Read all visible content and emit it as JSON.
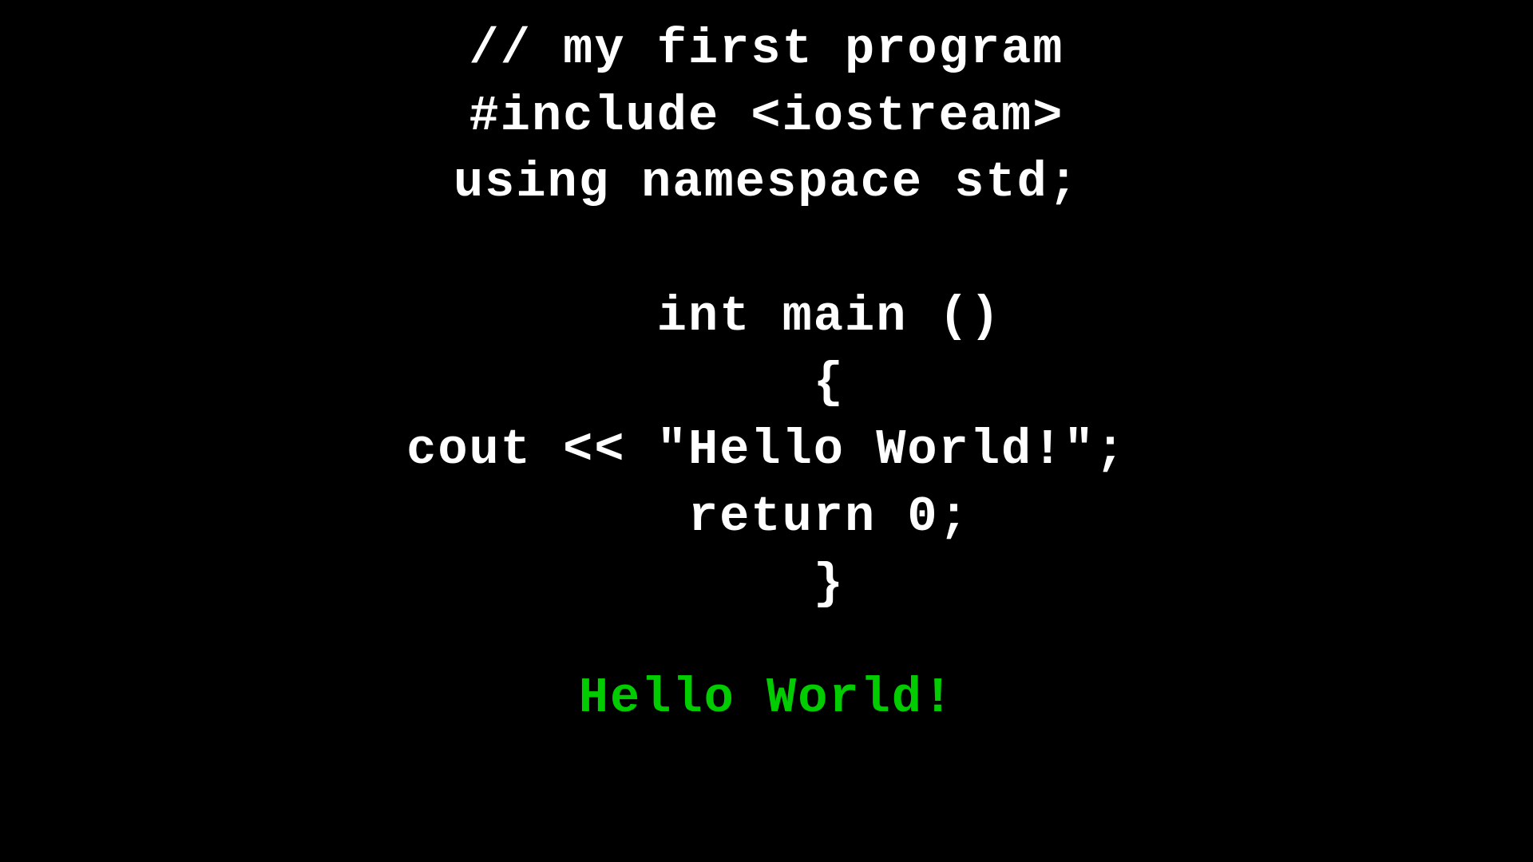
{
  "code": {
    "line1": "// my first program",
    "line2": "#include <iostream>",
    "line3": "using namespace std;",
    "line4": "",
    "line5": "    int main ()",
    "line6": "    {",
    "line7": "cout << \"Hello World!\";",
    "line8": "    return 0;",
    "line9": "    }",
    "output": "Hello World!"
  }
}
